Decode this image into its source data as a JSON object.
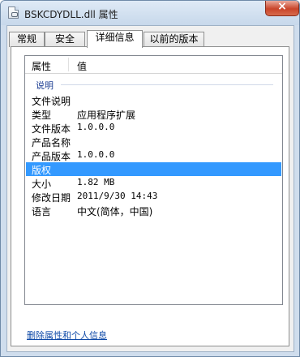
{
  "window": {
    "title": "BSKCDYDLL.dll 属性",
    "close_glyph": "×"
  },
  "tabs": [
    {
      "label": "常规",
      "active": false
    },
    {
      "label": "安全",
      "active": false
    },
    {
      "label": "详细信息",
      "active": true
    },
    {
      "label": "以前的版本",
      "active": false
    }
  ],
  "details": {
    "column_headers": {
      "property": "属性",
      "value": "值"
    },
    "group_label": "说明",
    "rows": [
      {
        "name": "文件说明",
        "value": "",
        "selected": false
      },
      {
        "name": "类型",
        "value": "应用程序扩展",
        "selected": false
      },
      {
        "name": "文件版本",
        "value": "1.0.0.0",
        "selected": false
      },
      {
        "name": "产品名称",
        "value": "",
        "selected": false
      },
      {
        "name": "产品版本",
        "value": "1.0.0.0",
        "selected": false
      },
      {
        "name": "版权",
        "value": "",
        "selected": true
      },
      {
        "name": "大小",
        "value": "1.82 MB",
        "selected": false
      },
      {
        "name": "修改日期",
        "value": "2011/9/30 14:43",
        "selected": false
      },
      {
        "name": "语言",
        "value": "中文(简体，中国)",
        "selected": false
      }
    ]
  },
  "remove_properties_link": "删除属性和个人信息",
  "colors": {
    "selection": "#3399ff",
    "link": "#0f4aa8",
    "group_label": "#1e3f93"
  }
}
